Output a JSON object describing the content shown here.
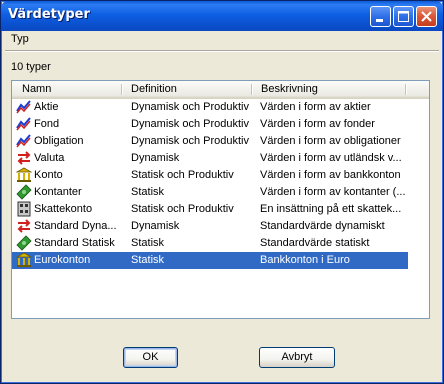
{
  "window": {
    "title": "Värdetyper"
  },
  "menu": {
    "items": [
      {
        "label": "Typ"
      }
    ]
  },
  "count_label": "10 typer",
  "table": {
    "columns": [
      "Namn",
      "Definition",
      "Beskrivning"
    ],
    "rows": [
      {
        "icon": "stock-chart-icon",
        "name": "Aktie",
        "definition": "Dynamisk och Produktiv",
        "description": "Värden i form av aktier"
      },
      {
        "icon": "fund-chart-icon",
        "name": "Fond",
        "definition": "Dynamisk och Produktiv",
        "description": "Värden i form av fonder"
      },
      {
        "icon": "bond-chart-icon",
        "name": "Obligation",
        "definition": "Dynamisk och Produktiv",
        "description": "Värden i form av obligationer"
      },
      {
        "icon": "currency-exchange-icon",
        "name": "Valuta",
        "definition": "Dynamisk",
        "description": "Värden i form av utländsk v..."
      },
      {
        "icon": "bank-icon",
        "name": "Konto",
        "definition": "Statisk och Produktiv",
        "description": "Värden i form av bankkonton"
      },
      {
        "icon": "cash-icon",
        "name": "Kontanter",
        "definition": "Statisk",
        "description": "Värden i form av kontanter (..."
      },
      {
        "icon": "tax-account-icon",
        "name": "Skattekonto",
        "definition": "Statisk och Produktiv",
        "description": "En insättning på ett skattek..."
      },
      {
        "icon": "currency-exchange-icon",
        "name": "Standard Dyna...",
        "definition": "Dynamisk",
        "description": "Standardvärde dynamiskt"
      },
      {
        "icon": "cash-icon",
        "name": "Standard Statisk",
        "definition": "Statisk",
        "description": "Standardvärde statiskt"
      },
      {
        "icon": "bank-icon",
        "name": "Eurokonton",
        "definition": "Statisk",
        "description": "Bankkonton i Euro"
      }
    ],
    "selected_index": 9
  },
  "buttons": {
    "ok": "OK",
    "cancel": "Avbryt"
  },
  "colors": {
    "selection": "#316ac5",
    "titlebar": "#0b52d0",
    "close_button": "#dc5b3c"
  }
}
